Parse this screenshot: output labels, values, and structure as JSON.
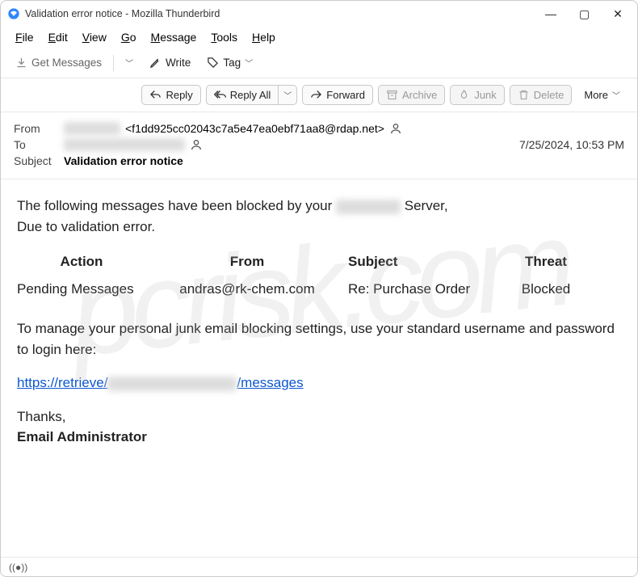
{
  "window": {
    "title": "Validation error notice - Mozilla Thunderbird"
  },
  "menubar": [
    "File",
    "Edit",
    "View",
    "Go",
    "Message",
    "Tools",
    "Help"
  ],
  "toolbar": {
    "get_messages": "Get Messages",
    "write": "Write",
    "tag": "Tag"
  },
  "actions": {
    "reply": "Reply",
    "reply_all": "Reply All",
    "forward": "Forward",
    "archive": "Archive",
    "junk": "Junk",
    "delete": "Delete",
    "more": "More"
  },
  "headers": {
    "from_label": "From",
    "from_addr": "<f1dd925cc02043c7a5e47ea0ebf71aa8@rdap.net>",
    "to_label": "To",
    "date": "7/25/2024, 10:53 PM",
    "subject_label": "Subject",
    "subject": "Validation error notice"
  },
  "body": {
    "intro_1": "The following messages have been blocked by your ",
    "intro_2": " Server,",
    "intro_3": "Due to validation error.",
    "table": {
      "head_action": "Action",
      "head_from": "From",
      "head_subject": "Subject",
      "head_threat": "Threat",
      "row_action": "Pending Messages",
      "row_from": "andras@rk-chem.com",
      "row_subject": "Re: Purchase Order",
      "row_threat": "Blocked"
    },
    "manage": "To manage your personal junk email blocking settings, use your standard username and password to login here:",
    "link_pre": "https://retrieve/",
    "link_post": "/messages",
    "thanks": "Thanks,",
    "signature": "Email Administrator"
  },
  "status": "((●))"
}
